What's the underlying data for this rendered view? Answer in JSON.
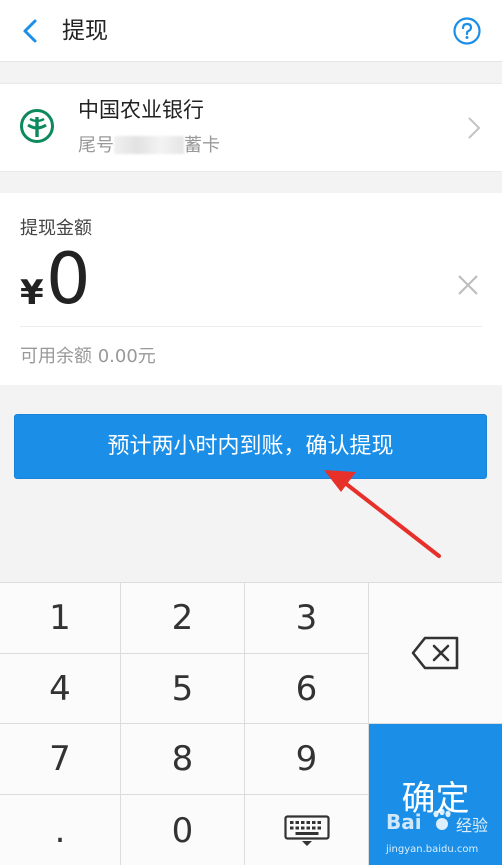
{
  "header": {
    "title": "提现",
    "back_icon": "chevron-left-icon",
    "help_icon": "question-circle-icon"
  },
  "bank_card": {
    "bank_name": "中国农业银行",
    "tail_prefix": "尾号",
    "tail_suffix": "蓄卡",
    "logo_icon": "abc-bank-logo",
    "arrow_icon": "chevron-right-icon"
  },
  "amount": {
    "label": "提现金额",
    "currency_symbol": "¥",
    "value": "0",
    "available_label": "可用余额 0.00元",
    "clear_icon": "close-icon"
  },
  "confirm_button": {
    "label": "预计两小时内到账，确认提现"
  },
  "keypad": {
    "keys": [
      "1",
      "2",
      "3",
      "4",
      "5",
      "6",
      "7",
      "8",
      "9",
      ".",
      "0"
    ],
    "hide_keyboard_icon": "keyboard-icon",
    "delete_icon": "backspace-icon",
    "ok_label": "确定"
  },
  "watermark": {
    "logo": "Bai",
    "brand": "经验",
    "url": "jingyan.baidu.com"
  },
  "colors": {
    "accent": "#1b8ee8",
    "bank_green": "#0c8a5c",
    "annotation_red": "#e8302a",
    "background": "#f3f3f3"
  }
}
